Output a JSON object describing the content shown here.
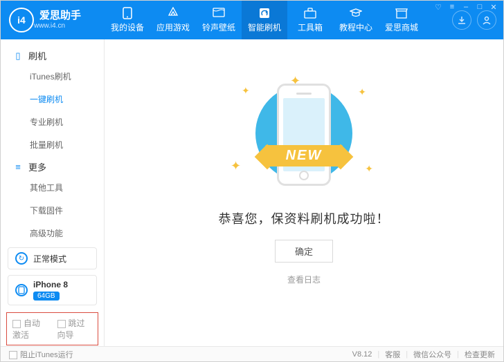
{
  "app": {
    "name": "爱思助手",
    "url": "www.i4.cn",
    "logo_text": "i4"
  },
  "nav": [
    {
      "label": "我的设备",
      "icon": "device"
    },
    {
      "label": "应用游戏",
      "icon": "apps"
    },
    {
      "label": "铃声壁纸",
      "icon": "media"
    },
    {
      "label": "智能刷机",
      "icon": "flash"
    },
    {
      "label": "工具箱",
      "icon": "toolbox"
    },
    {
      "label": "教程中心",
      "icon": "tutorial"
    },
    {
      "label": "爱思商城",
      "icon": "store"
    }
  ],
  "nav_active": 3,
  "sidebar": {
    "section1": {
      "title": "刷机",
      "items": [
        "iTunes刷机",
        "一键刷机",
        "专业刷机",
        "批量刷机"
      ],
      "active": 1
    },
    "section2": {
      "title": "更多",
      "items": [
        "其他工具",
        "下载固件",
        "高级功能"
      ]
    }
  },
  "mode": {
    "label": "正常模式"
  },
  "device": {
    "name": "iPhone 8",
    "storage": "64GB"
  },
  "options": {
    "auto_activate": "自动激活",
    "skip_wizard": "跳过向导"
  },
  "main": {
    "ribbon": "NEW",
    "message": "恭喜您，保资料刷机成功啦！",
    "ok": "确定",
    "log_link": "查看日志"
  },
  "footer": {
    "block_itunes": "阻止iTunes运行",
    "version": "V8.12",
    "service": "客服",
    "wechat": "微信公众号",
    "update": "检查更新"
  }
}
